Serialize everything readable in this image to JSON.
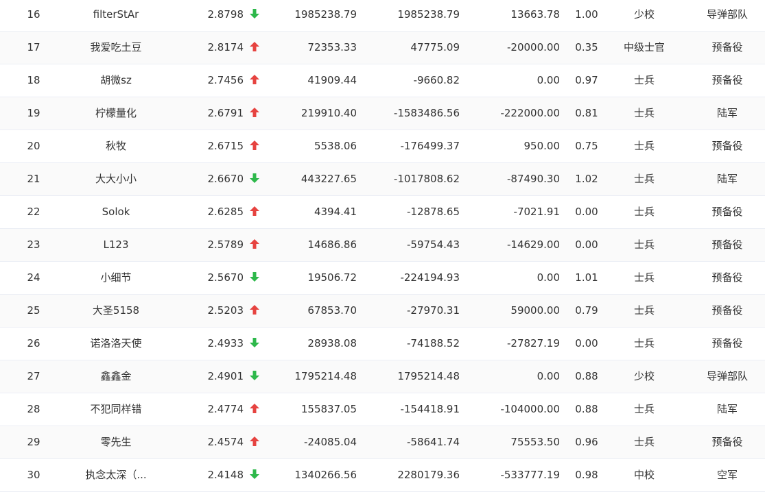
{
  "colors": {
    "up": "#e64340",
    "down": "#2eb84b",
    "border": "#ebeef5"
  },
  "rows": [
    {
      "rank": "16",
      "name": "filterStAr",
      "score": "2.8798",
      "dir": "down",
      "v1": "1985238.79",
      "v2": "1985238.79",
      "v3": "13663.78",
      "ratio": "1.00",
      "title": "少校",
      "unit": "导弹部队"
    },
    {
      "rank": "17",
      "name": "我爱吃土豆",
      "score": "2.8174",
      "dir": "up",
      "v1": "72353.33",
      "v2": "47775.09",
      "v3": "-20000.00",
      "ratio": "0.35",
      "title": "中级士官",
      "unit": "预备役"
    },
    {
      "rank": "18",
      "name": "胡微sz",
      "score": "2.7456",
      "dir": "up",
      "v1": "41909.44",
      "v2": "-9660.82",
      "v3": "0.00",
      "ratio": "0.97",
      "title": "士兵",
      "unit": "预备役"
    },
    {
      "rank": "19",
      "name": "柠檬量化",
      "score": "2.6791",
      "dir": "up",
      "v1": "219910.40",
      "v2": "-1583486.56",
      "v3": "-222000.00",
      "ratio": "0.81",
      "title": "士兵",
      "unit": "陆军"
    },
    {
      "rank": "20",
      "name": "秋牧",
      "score": "2.6715",
      "dir": "up",
      "v1": "5538.06",
      "v2": "-176499.37",
      "v3": "950.00",
      "ratio": "0.75",
      "title": "士兵",
      "unit": "预备役"
    },
    {
      "rank": "21",
      "name": "大大小小",
      "score": "2.6670",
      "dir": "down",
      "v1": "443227.65",
      "v2": "-1017808.62",
      "v3": "-87490.30",
      "ratio": "1.02",
      "title": "士兵",
      "unit": "陆军"
    },
    {
      "rank": "22",
      "name": "Solok",
      "score": "2.6285",
      "dir": "up",
      "v1": "4394.41",
      "v2": "-12878.65",
      "v3": "-7021.91",
      "ratio": "0.00",
      "title": "士兵",
      "unit": "预备役"
    },
    {
      "rank": "23",
      "name": "L123",
      "score": "2.5789",
      "dir": "up",
      "v1": "14686.86",
      "v2": "-59754.43",
      "v3": "-14629.00",
      "ratio": "0.00",
      "title": "士兵",
      "unit": "预备役"
    },
    {
      "rank": "24",
      "name": "小细节",
      "score": "2.5670",
      "dir": "down",
      "v1": "19506.72",
      "v2": "-224194.93",
      "v3": "0.00",
      "ratio": "1.01",
      "title": "士兵",
      "unit": "预备役"
    },
    {
      "rank": "25",
      "name": "大圣5158",
      "score": "2.5203",
      "dir": "up",
      "v1": "67853.70",
      "v2": "-27970.31",
      "v3": "59000.00",
      "ratio": "0.79",
      "title": "士兵",
      "unit": "预备役"
    },
    {
      "rank": "26",
      "name": "诺洛洛天使",
      "score": "2.4933",
      "dir": "down",
      "v1": "28938.08",
      "v2": "-74188.52",
      "v3": "-27827.19",
      "ratio": "0.00",
      "title": "士兵",
      "unit": "预备役"
    },
    {
      "rank": "27",
      "name": "鑫鑫金",
      "score": "2.4901",
      "dir": "down",
      "v1": "1795214.48",
      "v2": "1795214.48",
      "v3": "0.00",
      "ratio": "0.88",
      "title": "少校",
      "unit": "导弹部队"
    },
    {
      "rank": "28",
      "name": "不犯同样错",
      "score": "2.4774",
      "dir": "up",
      "v1": "155837.05",
      "v2": "-154418.91",
      "v3": "-104000.00",
      "ratio": "0.88",
      "title": "士兵",
      "unit": "陆军"
    },
    {
      "rank": "29",
      "name": "零先生",
      "score": "2.4574",
      "dir": "up",
      "v1": "-24085.04",
      "v2": "-58641.74",
      "v3": "75553.50",
      "ratio": "0.96",
      "title": "士兵",
      "unit": "预备役"
    },
    {
      "rank": "30",
      "name": "执念太深（...",
      "score": "2.4148",
      "dir": "down",
      "v1": "1340266.56",
      "v2": "2280179.36",
      "v3": "-533777.19",
      "ratio": "0.98",
      "title": "中校",
      "unit": "空军"
    }
  ]
}
